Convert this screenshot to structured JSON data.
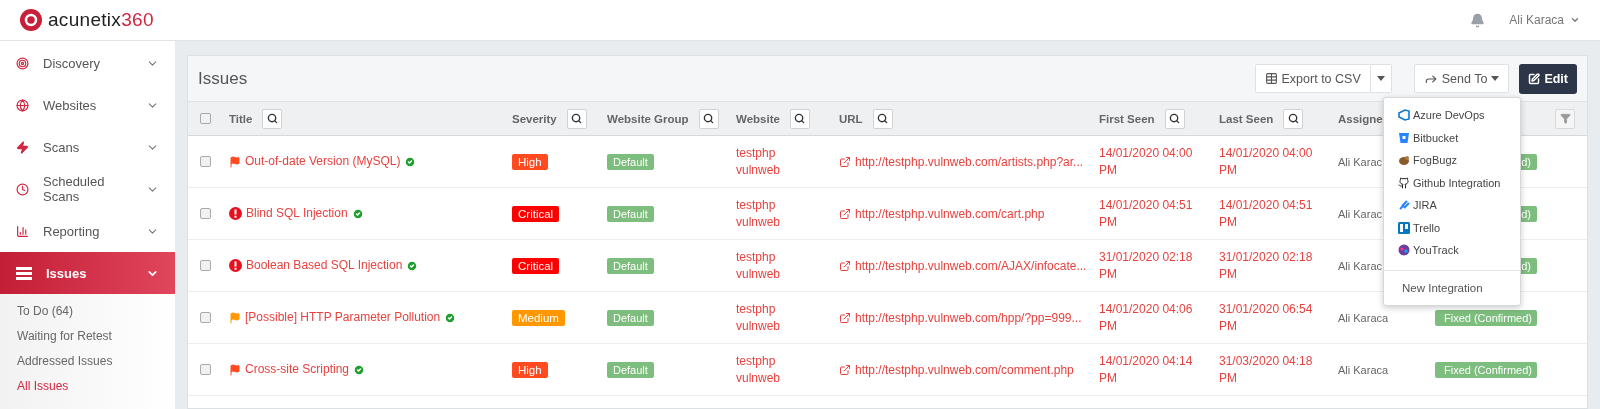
{
  "header": {
    "logo_text": "acunetix",
    "logo_suffix": "360",
    "user": "Ali Karaca"
  },
  "sidebar": {
    "items": [
      {
        "label": "Discovery",
        "selected": false
      },
      {
        "label": "Websites",
        "selected": false
      },
      {
        "label": "Scans",
        "selected": false
      },
      {
        "label": "Scheduled Scans",
        "selected": false
      },
      {
        "label": "Reporting",
        "selected": false
      },
      {
        "label": "Issues",
        "selected": true
      }
    ],
    "subitems": [
      {
        "label": "To Do (64)",
        "selected": false
      },
      {
        "label": "Waiting for Retest",
        "selected": false
      },
      {
        "label": "Addressed Issues",
        "selected": false
      },
      {
        "label": "All Issues",
        "selected": true
      }
    ]
  },
  "panel": {
    "title": "Issues",
    "export_button": "Export to CSV",
    "send_button": "Send To",
    "edit_button": "Edit"
  },
  "table": {
    "select_all_checked": false,
    "columns": [
      "Title",
      "Severity",
      "Website Group",
      "Website",
      "URL",
      "First Seen",
      "Last Seen",
      "Assigne"
    ],
    "rows": [
      {
        "checked": false,
        "kind": "flag",
        "title": "Out-of-date Version (MySQL)",
        "severity": {
          "label": "High",
          "kind": "high"
        },
        "group": "Default",
        "website": "testphp vulnweb",
        "url": "http://testphp.vulnweb.com/artists.php?ar...",
        "first_seen": "14/01/2020 04:00 PM",
        "last_seen": "14/01/2020 04:00 PM",
        "assignee": "Ali Karac",
        "status": {
          "label": "d)",
          "kind": "cut"
        }
      },
      {
        "checked": false,
        "kind": "alert",
        "title": "Blind SQL Injection",
        "severity": {
          "label": "Critical",
          "kind": "critical"
        },
        "group": "Default",
        "website": "testphp vulnweb",
        "url": "http://testphp.vulnweb.com/cart.php",
        "first_seen": "14/01/2020 04:51 PM",
        "last_seen": "14/01/2020 04:51 PM",
        "assignee": "Ali Karac",
        "status": {
          "label": "d)",
          "kind": "cut"
        }
      },
      {
        "checked": false,
        "kind": "alert",
        "title": "Boolean Based SQL Injection",
        "severity": {
          "label": "Critical",
          "kind": "critical"
        },
        "group": "Default",
        "website": "testphp vulnweb",
        "url": "http://testphp.vulnweb.com/AJAX/infocate...",
        "first_seen": "31/01/2020 02:18 PM",
        "last_seen": "31/01/2020 02:18 PM",
        "assignee": "Ali Karac",
        "status": {
          "label": "d)",
          "kind": "cut"
        }
      },
      {
        "checked": false,
        "kind": "flag",
        "title": "[Possible] HTTP Parameter Pollution",
        "severity": {
          "label": "Medium",
          "kind": "medium"
        },
        "group": "Default",
        "website": "testphp vulnweb",
        "url": "http://testphp.vulnweb.com/hpp/?pp=999...",
        "first_seen": "14/01/2020 04:06 PM",
        "last_seen": "31/01/2020 06:54 PM",
        "assignee": "Ali Karaca",
        "status": {
          "label": "Fixed (Confirmed)",
          "kind": "whole"
        }
      },
      {
        "checked": false,
        "kind": "flag",
        "title": "Cross-site Scripting",
        "severity": {
          "label": "High",
          "kind": "high"
        },
        "group": "Default",
        "website": "testphp vulnweb",
        "url": "http://testphp.vulnweb.com/comment.php",
        "first_seen": "14/01/2020 04:14 PM",
        "last_seen": "31/03/2020 04:18 PM",
        "assignee": "Ali Karaca",
        "status": {
          "label": "Fixed (Confirmed)",
          "kind": "whole"
        }
      }
    ]
  },
  "send_menu": {
    "items": [
      "Azure DevOps",
      "Bitbucket",
      "FogBugz",
      "Github Integration",
      "JIRA",
      "Trello",
      "YouTrack"
    ],
    "footer": "New Integration"
  }
}
